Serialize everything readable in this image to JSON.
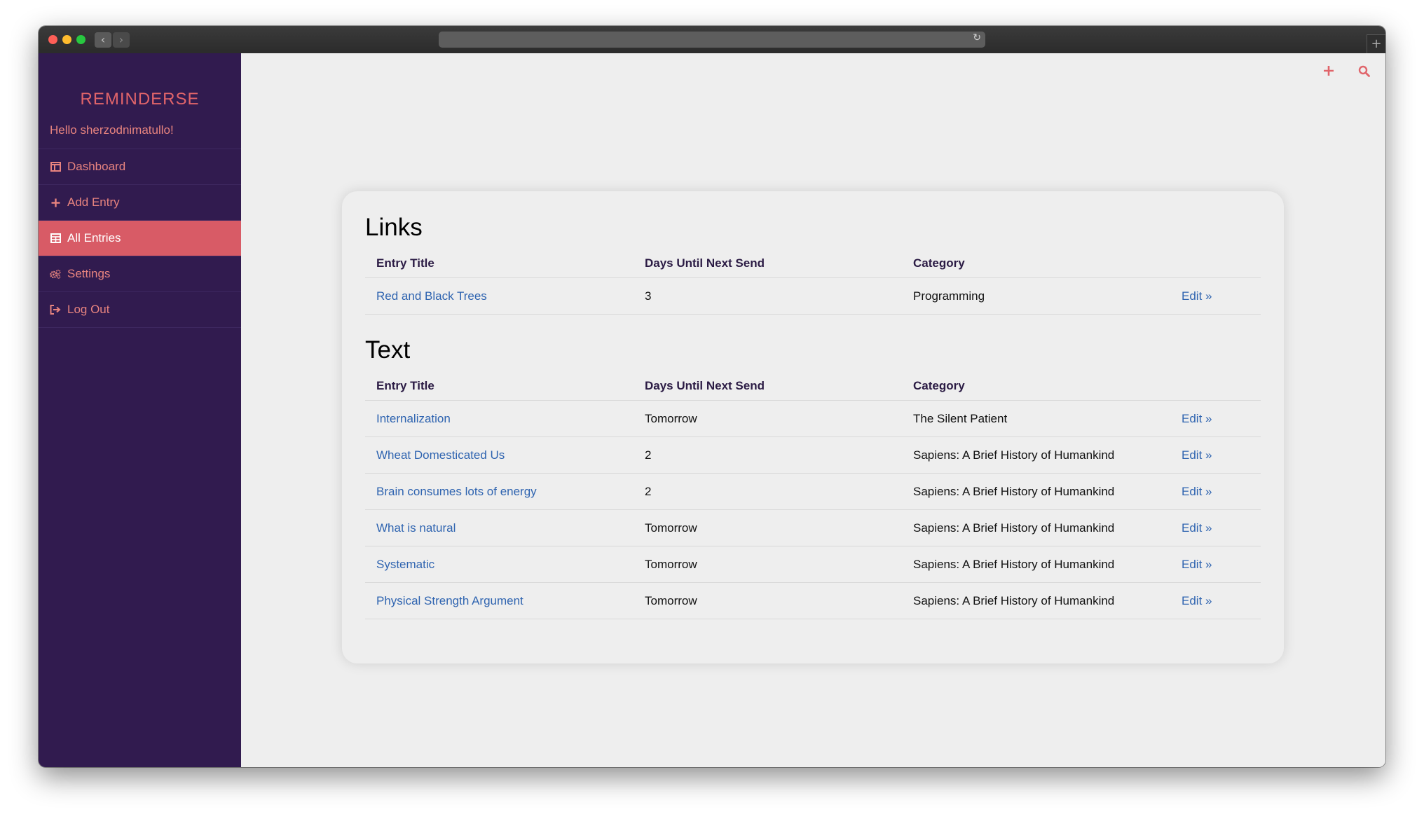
{
  "browser": {
    "back_glyph": "‹",
    "forward_glyph": "›",
    "reload_glyph": "↻",
    "new_tab_glyph": "+"
  },
  "sidebar": {
    "brand": "REMINDERSE",
    "greeting": "Hello sherzodnimatullo!",
    "items": [
      {
        "label": "Dashboard",
        "icon": "dashboard-icon",
        "active": false
      },
      {
        "label": "Add Entry",
        "icon": "plus-icon",
        "active": false
      },
      {
        "label": "All Entries",
        "icon": "table-icon",
        "active": true
      },
      {
        "label": "Settings",
        "icon": "gears-icon",
        "active": false
      },
      {
        "label": "Log Out",
        "icon": "sign-out-icon",
        "active": false
      }
    ]
  },
  "header_actions": {
    "add_icon": "plus-icon",
    "search_icon": "search-icon"
  },
  "colors": {
    "sidebar_bg": "#311b4f",
    "accent": "#d85b66",
    "link": "#2f64b0"
  },
  "sections": [
    {
      "title": "Links",
      "columns": [
        "Entry Title",
        "Days Until Next Send",
        "Category",
        ""
      ],
      "rows": [
        {
          "title": "Red and Black Trees",
          "days": "3",
          "category": "Programming",
          "action": "Edit »"
        }
      ]
    },
    {
      "title": "Text",
      "columns": [
        "Entry Title",
        "Days Until Next Send",
        "Category",
        ""
      ],
      "rows": [
        {
          "title": "Internalization",
          "days": "Tomorrow",
          "category": "The Silent Patient",
          "action": "Edit »"
        },
        {
          "title": "Wheat Domesticated Us",
          "days": "2",
          "category": "Sapiens: A Brief History of Humankind",
          "action": "Edit »"
        },
        {
          "title": "Brain consumes lots of energy",
          "days": "2",
          "category": "Sapiens: A Brief History of Humankind",
          "action": "Edit »"
        },
        {
          "title": "What is natural",
          "days": "Tomorrow",
          "category": "Sapiens: A Brief History of Humankind",
          "action": "Edit »"
        },
        {
          "title": "Systematic",
          "days": "Tomorrow",
          "category": "Sapiens: A Brief History of Humankind",
          "action": "Edit »"
        },
        {
          "title": "Physical Strength Argument",
          "days": "Tomorrow",
          "category": "Sapiens: A Brief History of Humankind",
          "action": "Edit »"
        }
      ]
    }
  ]
}
